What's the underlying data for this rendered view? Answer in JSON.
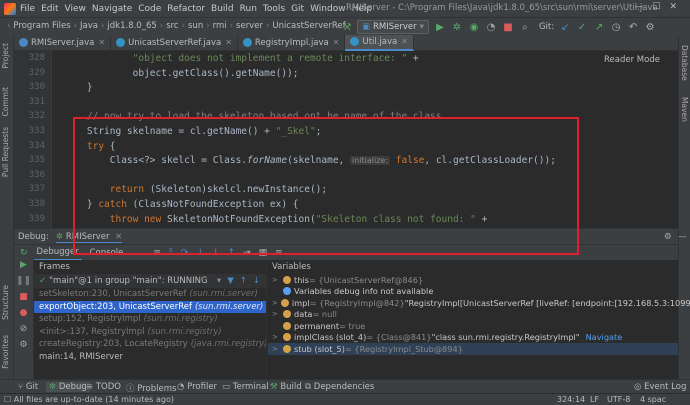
{
  "window": {
    "title": "RMIServer - C:\\Program Files\\Java\\jdk1.8.0_65\\src\\sun\\rmi\\server\\Util.java",
    "menu": [
      "File",
      "Edit",
      "View",
      "Navigate",
      "Code",
      "Refactor",
      "Build",
      "Run",
      "Tools",
      "Git",
      "Window",
      "Help"
    ]
  },
  "breadcrumb": [
    "Program Files",
    "Java",
    "jdk1.8.0_65",
    "src",
    "sun",
    "rmi",
    "server",
    "UnicastServerRef"
  ],
  "toolbar": {
    "run_config": "RMIServer",
    "git_label": "Git:"
  },
  "tabs": [
    {
      "label": "RMIServer.java",
      "color": "#4a88c7",
      "active": false
    },
    {
      "label": "UnicastServerRef.java",
      "color": "#3592c4",
      "active": false
    },
    {
      "label": "RegistryImpl.java",
      "color": "#3592c4",
      "active": false
    },
    {
      "label": "Util.java",
      "color": "#3592c4",
      "active": true
    }
  ],
  "editor": {
    "reader_mode": "Reader Mode",
    "lines": [
      {
        "num": "328",
        "code": [
          {
            "t": "            ",
            "c": ""
          },
          {
            "t": "\"object does not implement a remote interface: \"",
            "c": "str"
          },
          {
            "t": " +",
            "c": ""
          }
        ]
      },
      {
        "num": "329",
        "code": [
          {
            "t": "            object.getClass().getName());",
            "c": ""
          }
        ]
      },
      {
        "num": "330",
        "code": [
          {
            "t": "    }",
            "c": ""
          }
        ]
      },
      {
        "num": "331",
        "code": [
          {
            "t": "",
            "c": ""
          }
        ]
      },
      {
        "num": "332",
        "code": [
          {
            "t": "    // now try to load the skeleton based ont he name of the class",
            "c": "cmt"
          }
        ]
      },
      {
        "num": "333",
        "code": [
          {
            "t": "    String skelname = cl.getName() + ",
            "c": ""
          },
          {
            "t": "\"_Skel\"",
            "c": "str"
          },
          {
            "t": ";",
            "c": ""
          }
        ]
      },
      {
        "num": "334",
        "code": [
          {
            "t": "    ",
            "c": ""
          },
          {
            "t": "try",
            "c": "kw"
          },
          {
            "t": " {",
            "c": ""
          }
        ]
      },
      {
        "num": "335",
        "code": [
          {
            "t": "        Class<?> skelcl = Class.",
            "c": ""
          },
          {
            "t": "forName",
            "c": "it"
          },
          {
            "t": "(skelname, ",
            "c": ""
          },
          {
            "t": "initialize:",
            "c": "hint"
          },
          {
            "t": " ",
            "c": ""
          },
          {
            "t": "false",
            "c": "kw"
          },
          {
            "t": ", cl.getClassLoader());",
            "c": ""
          }
        ]
      },
      {
        "num": "336",
        "code": [
          {
            "t": "",
            "c": ""
          }
        ]
      },
      {
        "num": "337",
        "code": [
          {
            "t": "        ",
            "c": ""
          },
          {
            "t": "return",
            "c": "kw"
          },
          {
            "t": " (Skeleton)skelcl.newInstance();",
            "c": ""
          }
        ]
      },
      {
        "num": "338",
        "code": [
          {
            "t": "    } ",
            "c": ""
          },
          {
            "t": "catch",
            "c": "kw"
          },
          {
            "t": " (ClassNotFoundException ex) {",
            "c": ""
          }
        ]
      },
      {
        "num": "339",
        "code": [
          {
            "t": "        ",
            "c": ""
          },
          {
            "t": "throw new",
            "c": "kw"
          },
          {
            "t": " SkeletonNotFoundException(",
            "c": ""
          },
          {
            "t": "\"Skeleton class not found: \"",
            "c": "str"
          },
          {
            "t": " +",
            "c": ""
          }
        ]
      }
    ]
  },
  "debug": {
    "title": "Debug:",
    "session": "RMIServer",
    "tabs": [
      "Debugger",
      "Console"
    ],
    "frames_label": "Frames",
    "variables_label": "Variables",
    "thread": "\"main\"@1 in group \"main\": RUNNING",
    "frames": [
      {
        "method": "setSkeleton:230, UnicastServerRef",
        "pkg": "(sun.rmi.server)",
        "state": "dim"
      },
      {
        "method": "exportObject:203, UnicastServerRef",
        "pkg": "(sun.rmi.server)",
        "state": "sel"
      },
      {
        "method": "setup:152, RegistryImpl",
        "pkg": "(sun.rmi.registry)",
        "state": "dim"
      },
      {
        "method": "<init>:137, RegistryImpl",
        "pkg": "(sun.rmi.registry)",
        "state": "dim"
      },
      {
        "method": "createRegistry:203, LocateRegistry",
        "pkg": "(java.rmi.registry)",
        "state": "dim"
      },
      {
        "method": "main:14, RMIServer",
        "pkg": "",
        "state": "normal"
      }
    ],
    "variables": [
      {
        "expand": ">",
        "icon": "#d4a14a",
        "name": "this",
        "type": " = {UnicastServerRef@846}",
        "value": "",
        "link": ""
      },
      {
        "expand": "",
        "icon": "#589df6",
        "name": "Variables debug info not available",
        "type": "",
        "value": "",
        "link": ""
      },
      {
        "expand": ">",
        "icon": "#d4a14a",
        "name": "impl",
        "type": " = {RegistryImpl@842}",
        "value": " \"RegistryImpl[UnicastServerRef [liveRef: [endpoint:[192.168.5.3:1099",
        "link": ""
      },
      {
        "expand": ">",
        "icon": "#d4a14a",
        "name": "data",
        "type": " = null",
        "value": "",
        "link": ""
      },
      {
        "expand": "",
        "icon": "#d4a14a",
        "name": "permanent",
        "type": " = true",
        "value": "",
        "link": ""
      },
      {
        "expand": ">",
        "icon": "#d4a14a",
        "name": "implClass (slot_4)",
        "type": " = {Class@841}",
        "value": " \"class sun.rmi.registry.RegistryImpl\"",
        "link": "Navigate"
      },
      {
        "expand": ">",
        "icon": "#d4a14a",
        "name": "stub (slot_5)",
        "type": " = {RegistryImpl_Stub@894}",
        "value": "",
        "link": ""
      }
    ]
  },
  "bottom_tools": [
    "Git",
    "Debug",
    "TODO",
    "Problems",
    "Profiler",
    "Terminal",
    "Build",
    "Dependencies",
    "Event Log"
  ],
  "status": {
    "message": "All files are up-to-date (14 minutes ago)",
    "position": "324:14",
    "line_sep": "LF",
    "encoding": "UTF-8",
    "indent": "4 spac"
  },
  "left_stripe": [
    "Project",
    "Commit",
    "Pull Requests",
    "Structure",
    "Favorites"
  ],
  "right_stripe": [
    "Database",
    "Maven"
  ]
}
